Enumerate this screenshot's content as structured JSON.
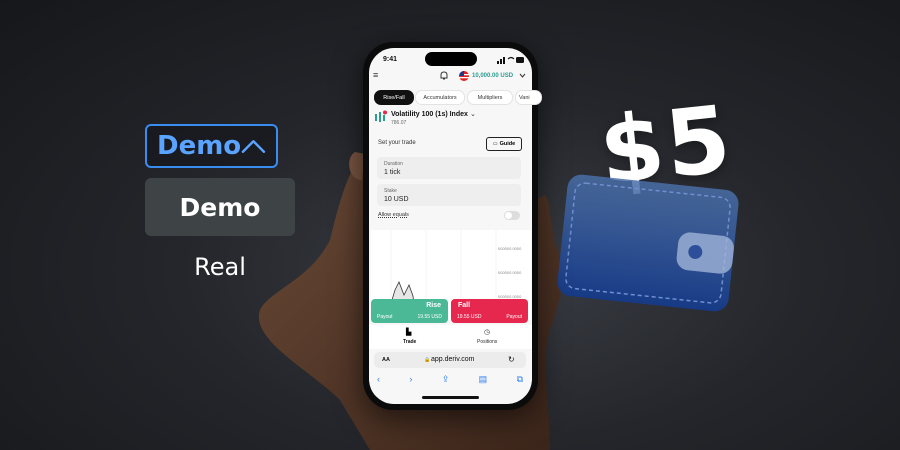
{
  "account_selector": {
    "selected": "Demo",
    "options": [
      "Demo",
      "Real"
    ]
  },
  "promo": {
    "amount": "$5"
  },
  "phone": {
    "time": "9:41",
    "balance": "10,000.00 USD",
    "tabs": [
      "Rise/Fall",
      "Accumulators",
      "Multipliers",
      "Vani"
    ],
    "market": {
      "name": "Volatility 100 (1s) Index",
      "price": "786.07"
    },
    "set_trade_label": "Set your trade",
    "guide_label": "Guide",
    "duration": {
      "label": "Duration",
      "value": "1 tick"
    },
    "stake": {
      "label": "Stake",
      "value": "10 USD"
    },
    "allow_equals": "Allow equals",
    "chart_ticks": [
      "000000.0000",
      "000000.0000",
      "000000.0000"
    ],
    "rise": {
      "label": "Rise",
      "payout_label": "Payout",
      "payout_value": "19.55 USD"
    },
    "fall": {
      "label": "Fall",
      "payout_label": "Payout",
      "payout_value": "19.55 USD"
    },
    "nav": {
      "trade": "Trade",
      "positions": "Positions"
    },
    "browser": {
      "aa": "AA",
      "url": "app.deriv.com"
    }
  },
  "colors": {
    "accent_blue": "#3a8df0",
    "rise_green": "#4bb896",
    "fall_red": "#e6274e",
    "balance_teal": "#2a9d8f"
  }
}
